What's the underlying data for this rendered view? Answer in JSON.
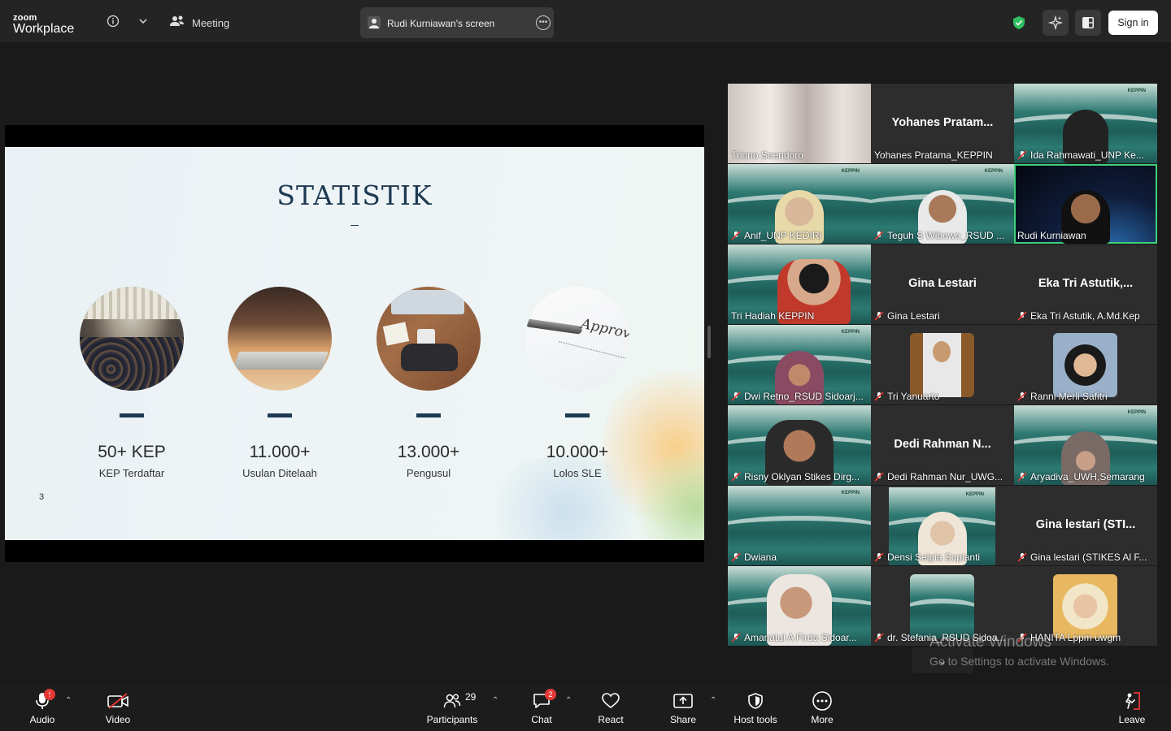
{
  "app": {
    "logo_small": "zoom",
    "logo_big": "Workplace",
    "meeting_label": "Meeting",
    "screen_share_label": "Rudi Kurniawan's screen",
    "sign_in": "Sign in"
  },
  "slide": {
    "title": "STATISTIK",
    "page_number": "3",
    "stats": [
      {
        "value": "50+ KEP",
        "caption": "KEP Terdaftar"
      },
      {
        "value": "11.000+",
        "caption": "Usulan Ditelaah"
      },
      {
        "value": "13.000+",
        "caption": "Pengusul"
      },
      {
        "value": "10.000+",
        "caption": "Lolos SLE"
      }
    ],
    "approve_text": "Approv"
  },
  "participants": [
    {
      "name": "Triono Soendoro",
      "muted": false,
      "display": "video"
    },
    {
      "name": "Yohanes Pratama_KEPPIN",
      "muted": false,
      "display": "name",
      "bigname": "Yohanes  Pratam..."
    },
    {
      "name": "Ida Rahmawati_UNP Ke...",
      "muted": true,
      "display": "video"
    },
    {
      "name": "Anif_UNP KEDIRI",
      "muted": true,
      "display": "video"
    },
    {
      "name": "Teguh S Wibowo_RSUD ...",
      "muted": true,
      "display": "video"
    },
    {
      "name": "Rudi Kurniawan",
      "muted": false,
      "display": "video",
      "active": true
    },
    {
      "name": "Tri Hadiah KEPPIN",
      "muted": false,
      "display": "video"
    },
    {
      "name": "Gina Lestari",
      "muted": true,
      "display": "name",
      "bigname": "Gina Lestari"
    },
    {
      "name": "Eka Tri Astutik, A.Md.Kep",
      "muted": true,
      "display": "name",
      "bigname": "Eka Tri Astutik,..."
    },
    {
      "name": "Dwi Retno_RSUD Sidoarj...",
      "muted": true,
      "display": "video"
    },
    {
      "name": "Tri Yanuarto",
      "muted": true,
      "display": "avatar"
    },
    {
      "name": "Ranni Merli Safitri",
      "muted": true,
      "display": "avatar"
    },
    {
      "name": "Risny Oklyan Stikes Dirg...",
      "muted": true,
      "display": "video"
    },
    {
      "name": "Dedi Rahman Nur_UWG...",
      "muted": true,
      "display": "name",
      "bigname": "Dedi Rahman N..."
    },
    {
      "name": "Aryadiva_UWH,Semarang",
      "muted": true,
      "display": "video"
    },
    {
      "name": "Dwiana",
      "muted": true,
      "display": "video"
    },
    {
      "name": "Densi Selpia Sopianti",
      "muted": true,
      "display": "avatar"
    },
    {
      "name": "Gina lestari (STIKES Al F...",
      "muted": true,
      "display": "name",
      "bigname": "Gina lestari (STI..."
    },
    {
      "name": "Amanatul A Firda Sidoar...",
      "muted": true,
      "display": "video"
    },
    {
      "name": "dr. Stefania_RSUD Sidoa...",
      "muted": true,
      "display": "avatar"
    },
    {
      "name": "HANITA Lppm uwgm",
      "muted": true,
      "display": "avatar"
    }
  ],
  "watermark": {
    "line1": "Activate Windows",
    "line2": "Go to Settings to activate Windows."
  },
  "toolbar": {
    "audio": "Audio",
    "audio_badge": "!",
    "video": "Video",
    "participants": "Participants",
    "participants_count": "29",
    "chat": "Chat",
    "chat_badge": "2",
    "react": "React",
    "share": "Share",
    "host_tools": "Host tools",
    "more": "More",
    "leave": "Leave"
  },
  "colors": {
    "accent_green": "#3fd07a",
    "leave_red": "#e53935",
    "slide_navy": "#1d3a52"
  }
}
